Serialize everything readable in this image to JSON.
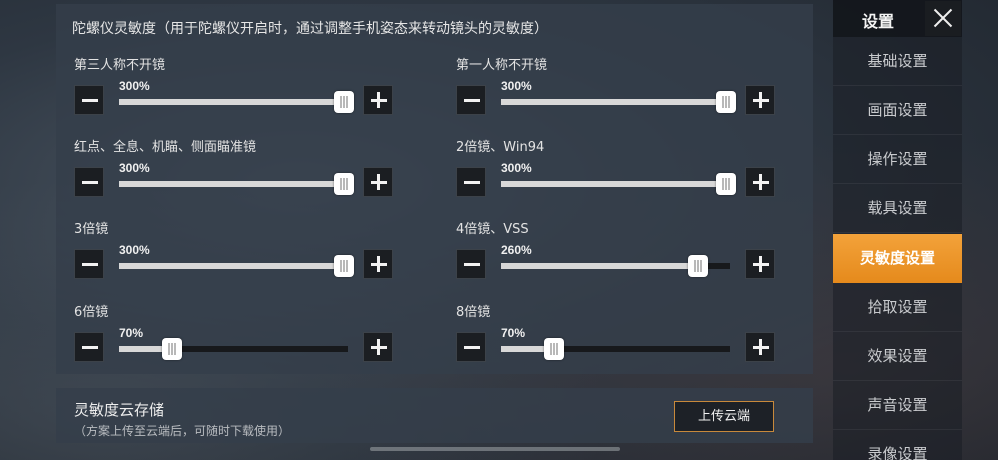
{
  "gyro": {
    "title": "陀螺仪灵敏度（用于陀螺仪开启时，通过调整手机姿态来转动镜头的灵敏度）",
    "settings": [
      {
        "label": "第三人称不开镜",
        "value": "300%",
        "level_pct": 100
      },
      {
        "label": "第一人称不开镜",
        "value": "300%",
        "level_pct": 100
      },
      {
        "label": "红点、全息、机瞄、侧面瞄准镜",
        "value": "300%",
        "level_pct": 100
      },
      {
        "label": "2倍镜、Win94",
        "value": "300%",
        "level_pct": 100
      },
      {
        "label": "3倍镜",
        "value": "300%",
        "level_pct": 100
      },
      {
        "label": "4倍镜、VSS",
        "value": "260%",
        "level_pct": 86
      },
      {
        "label": "6倍镜",
        "value": "70%",
        "level_pct": 23
      },
      {
        "label": "8倍镜",
        "value": "70%",
        "level_pct": 23
      }
    ]
  },
  "cloud": {
    "title": "灵敏度云存储",
    "subtitle": "（方案上传至云端后，可随时下载使用）",
    "upload_label": "上传云端",
    "accent": "#c8893b"
  },
  "sidebar": {
    "title": "设置",
    "items": [
      {
        "label": "基础设置",
        "active": false
      },
      {
        "label": "画面设置",
        "active": false
      },
      {
        "label": "操作设置",
        "active": false
      },
      {
        "label": "载具设置",
        "active": false
      },
      {
        "label": "灵敏度设置",
        "active": true
      },
      {
        "label": "拾取设置",
        "active": false
      },
      {
        "label": "效果设置",
        "active": false
      },
      {
        "label": "声音设置",
        "active": false
      },
      {
        "label": "录像设置",
        "active": false
      }
    ],
    "active_color": "#ee9a2e"
  }
}
